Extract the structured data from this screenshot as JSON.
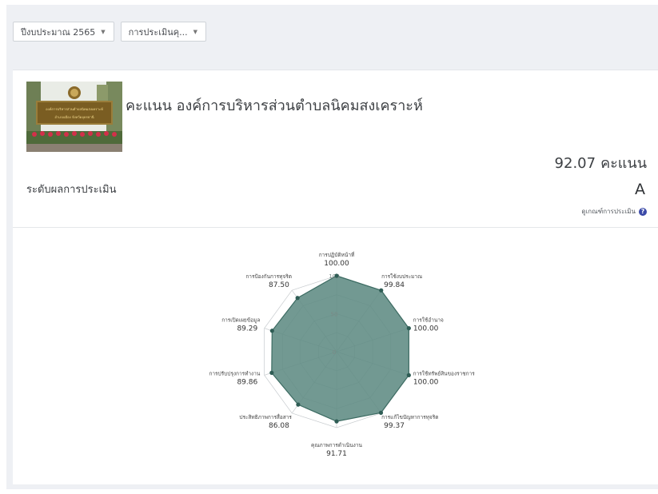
{
  "filters": {
    "year": "ปีงบประมาณ 2565",
    "assessment": "การประเมินคุ..."
  },
  "org": {
    "sign_line1": "องค์การบริหารส่วนตำบลนิคมสงเคราะห์",
    "sign_line2": "อำเภอเมือง จังหวัดอุดรธานี",
    "title": "คะแนน องค์การบริหารส่วนตำบลนิคมสงเคราะห์"
  },
  "result": {
    "score": "92.07",
    "score_unit": "คะแนน",
    "level_label": "ระดับผลการประเมิน",
    "grade": "A",
    "criteria_link": "ดูเกณฑ์การประเมิน"
  },
  "colors": {
    "fill": "#5e8b83",
    "stroke": "#3c6b62",
    "point": "#2f5d55",
    "grid": "#c8cccf"
  },
  "chart_data": {
    "type": "radar",
    "max": 100,
    "ticks": [
      "0",
      "50",
      "100"
    ],
    "axes": [
      {
        "label": "การปฏิบัติหน้าที่",
        "value": 100.0,
        "display": "100.00"
      },
      {
        "label": "การใช้งบประมาณ",
        "value": 99.84,
        "display": "99.84"
      },
      {
        "label": "การใช้อำนาจ",
        "value": 100.0,
        "display": "100.00"
      },
      {
        "label": "การใช้ทรัพย์สินของราชการ",
        "value": 100.0,
        "display": "100.00"
      },
      {
        "label": "การแก้ไขปัญหาการทุจริต",
        "value": 99.37,
        "display": "99.37"
      },
      {
        "label": "คุณภาพการดำเนินงาน",
        "value": 91.71,
        "display": "91.71"
      },
      {
        "label": "ประสิทธิภาพการสื่อสาร",
        "value": 86.08,
        "display": "86.08"
      },
      {
        "label": "การปรับปรุงการทำงาน",
        "value": 89.86,
        "display": "89.86"
      },
      {
        "label": "การเปิดเผยข้อมูล",
        "value": 89.29,
        "display": "89.29"
      },
      {
        "label": "การป้องกันการทุจริต",
        "value": 87.5,
        "display": "87.50"
      }
    ]
  }
}
